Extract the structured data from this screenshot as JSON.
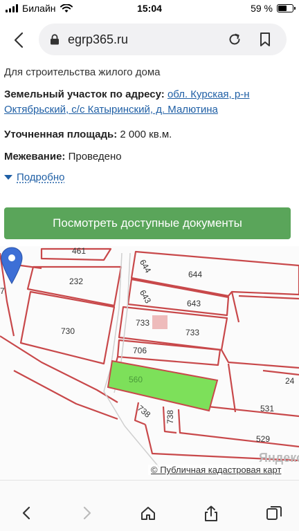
{
  "status": {
    "carrier": "Билайн",
    "time": "15:04",
    "battery_label": "59 %",
    "battery_level": 0.59
  },
  "browser": {
    "url": "egrp365.ru"
  },
  "details": {
    "purpose": "Для строительства жилого дома",
    "address_label": "Земельный участок по адресу:",
    "address_line1": "обл. Курская, р-н",
    "address_line2": "Октябрьский, с/с Катыринский, д. Малютина",
    "area_label": "Уточненная площадь:",
    "area_value": "2 000 кв.м.",
    "survey_label": "Межевание:",
    "survey_value": "Проведено",
    "more_label": "Подробно",
    "docs_button": "Посмотреть доступные документы"
  },
  "map": {
    "parcels": [
      "461",
      "232",
      "644",
      "644",
      "643",
      "643",
      "7",
      "730",
      "733",
      "733",
      "706",
      "560",
      "738",
      "738",
      "531",
      "24",
      "529"
    ],
    "attribution": "© Публичная кадастровая карт",
    "watermark": "Яндекс",
    "highlight_color": "#7de05a",
    "line_color": "#c8484a",
    "pin_color": "#3d6fd6"
  },
  "colors": {
    "button_green": "#5aa55a",
    "link_blue": "#1f5fa5"
  }
}
